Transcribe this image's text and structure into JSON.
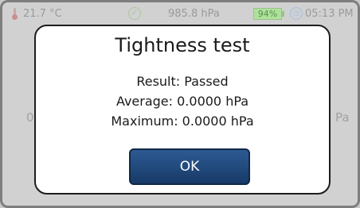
{
  "status_bar": {
    "temperature": "21.7 °C",
    "pressure": "985.8 hPa",
    "battery": "94%",
    "time": "05:13 PM",
    "icons": [
      "thermometer-icon",
      "check-circle-icon",
      "battery-icon",
      "clock-icon"
    ]
  },
  "background": {
    "left_value_fragment": "0.",
    "right_unit_fragment": "Pa"
  },
  "dialog": {
    "title": "Tightness test",
    "result": "Result: Passed",
    "average": "Average: 0.0000 hPa",
    "maximum": "Maximum: 0.0000 hPa",
    "ok_label": "OK"
  },
  "colors": {
    "button": "#1f477b",
    "battery_fill": "#aee29a"
  }
}
